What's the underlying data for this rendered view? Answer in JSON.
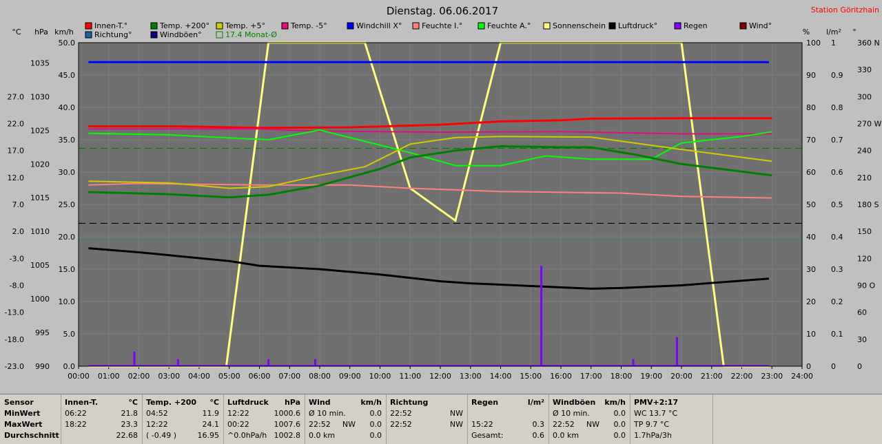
{
  "title": "Dienstag. 06.06.2017",
  "station": "Station Göritzhain",
  "colors": {
    "background": "#c0c0c0",
    "plot": "#707070",
    "grid": "#808080"
  },
  "axis_heads": {
    "temp": "°C",
    "press": "hPa",
    "wind": "km/h",
    "percent": "%",
    "rain": "l/m²",
    "dir": "°"
  },
  "legend": [
    {
      "label": "Innen-T.°",
      "color": "#ff0000"
    },
    {
      "label": "Temp. +200°",
      "color": "#008000"
    },
    {
      "label": "Temp. +5°",
      "color": "#cccc00"
    },
    {
      "label": "Temp. -5°",
      "color": "#e0107a"
    },
    {
      "label": "Windchill X°",
      "color": "#0000ff"
    },
    {
      "label": "Feuchte I.°",
      "color": "#ff8080"
    },
    {
      "label": "Feuchte A.°",
      "color": "#00ff00"
    },
    {
      "label": "Sonnenschein",
      "color": "#ffff80"
    },
    {
      "label": "Luftdruck°",
      "color": "#000000"
    },
    {
      "label": "Regen",
      "color": "#8000ff"
    },
    {
      "label": "Wind°",
      "color": "#800000"
    },
    {
      "label": "Richtung°",
      "color": "#2060a0"
    },
    {
      "label": "Windböen°",
      "color": "#000080"
    },
    {
      "label": "17.4 Monat-Ø",
      "color": "#008000",
      "outline": true
    }
  ],
  "chart_data": {
    "type": "line",
    "title": "Dienstag. 06.06.2017",
    "x_range": [
      0,
      24
    ],
    "x_ticks": [
      "00:00",
      "01:00",
      "02:00",
      "03:00",
      "04:00",
      "05:00",
      "06:00",
      "07:00",
      "08:00",
      "09:00",
      "10:00",
      "11:00",
      "12:00",
      "13:00",
      "14:00",
      "15:00",
      "16:00",
      "17:00",
      "18:00",
      "19:00",
      "20:00",
      "21:00",
      "22:00",
      "23:00",
      "24:00"
    ],
    "axes": {
      "temp": {
        "range": [
          -23.0,
          37.0
        ],
        "ticks": [
          "27.0",
          "22.0",
          "17.0",
          "12.0",
          "7.0",
          "2.0",
          "-3.0",
          "-8.0",
          "-13.0",
          "-18.0",
          "-23.0"
        ]
      },
      "press": {
        "range": [
          990,
          1038
        ],
        "ticks": [
          "1035",
          "1030",
          "1025",
          "1020",
          "1015",
          "1010",
          "1005",
          "1000",
          "995",
          "990"
        ]
      },
      "wind": {
        "range": [
          0,
          50
        ],
        "ticks": [
          "50.0",
          "45.0",
          "40.0",
          "35.0",
          "30.0",
          "25.0",
          "20.0",
          "15.0",
          "10.0",
          "5.0",
          "0.0"
        ]
      },
      "percent": {
        "range": [
          0,
          100
        ],
        "ticks": [
          "100",
          "90",
          "80",
          "70",
          "60",
          "50",
          "40",
          "30",
          "20",
          "10",
          "0"
        ]
      },
      "rain": {
        "range": [
          0,
          1
        ],
        "ticks": [
          "1",
          "0.9",
          "0.8",
          "0.7",
          "0.6",
          "0.5",
          "0.4",
          "0.3",
          "0.2",
          "0.1",
          "0"
        ]
      },
      "dir": {
        "range": [
          0,
          360
        ],
        "ticks": [
          "360 N",
          "330",
          "300",
          "270 W",
          "240",
          "210",
          "180 S",
          "150",
          "120",
          "90 O",
          "60",
          "30",
          "0"
        ]
      }
    },
    "series": [
      {
        "name": "Innen-T.°",
        "axis": "temp",
        "color": "#ff0000",
        "width": 3,
        "x": [
          0.33,
          3,
          6,
          9,
          12,
          14,
          16,
          17,
          20,
          23
        ],
        "y": [
          21.5,
          21.5,
          21.2,
          21.3,
          21.8,
          22.4,
          22.6,
          22.9,
          23.0,
          23.0
        ]
      },
      {
        "name": "Temp. -5°",
        "axis": "temp",
        "color": "#e0107a",
        "width": 2,
        "x": [
          0.33,
          6,
          8,
          12,
          16,
          20,
          23
        ],
        "y": [
          21.0,
          21.0,
          20.6,
          20.4,
          20.5,
          20.1,
          20.1
        ]
      },
      {
        "name": "Feuchte I.°",
        "axis": "percent",
        "color": "#ff8080",
        "width": 2,
        "x": [
          0.33,
          2,
          6,
          9,
          11,
          14,
          18,
          20,
          23
        ],
        "y": [
          56,
          56.5,
          56,
          56,
          55,
          54,
          53.5,
          52.5,
          52
        ]
      },
      {
        "name": "Feuchte A.°",
        "axis": "percent",
        "color": "#00ff00",
        "width": 2,
        "x": [
          0.33,
          3,
          6.3,
          8,
          11,
          12.5,
          14,
          15.5,
          17,
          19,
          20,
          22,
          23
        ],
        "y": [
          72,
          71.5,
          70,
          73,
          66,
          62,
          62,
          65,
          64,
          64,
          69,
          71,
          72.5
        ]
      },
      {
        "name": "Temp. +5°",
        "axis": "temp",
        "color": "#cccc00",
        "width": 2,
        "x": [
          0.33,
          3,
          5,
          6.3,
          8,
          9.5,
          11,
          12.5,
          14,
          17,
          20,
          23
        ],
        "y": [
          11.3,
          11.0,
          10.0,
          10.3,
          12.4,
          14.0,
          18.2,
          19.4,
          19.6,
          19.5,
          17.2,
          15.0
        ]
      },
      {
        "name": "Temp. +200°",
        "axis": "temp",
        "color": "#008000",
        "width": 3,
        "x": [
          0.33,
          3,
          5,
          6.3,
          8,
          10,
          11,
          12.5,
          14,
          16,
          17,
          18.5,
          20,
          23
        ],
        "y": [
          9.3,
          8.9,
          8.3,
          8.8,
          10.5,
          13.6,
          15.7,
          17.0,
          17.8,
          17.6,
          17.6,
          16.2,
          14.5,
          12.4
        ]
      },
      {
        "name": "Luftdruck°",
        "axis": "press",
        "color": "#000000",
        "width": 3,
        "x": [
          0.33,
          2,
          5,
          6,
          8,
          10,
          12,
          13,
          15,
          17,
          18,
          20,
          22.9
        ],
        "y": [
          1007.5,
          1006.9,
          1005.6,
          1004.9,
          1004.4,
          1003.6,
          1002.6,
          1002.3,
          1001.9,
          1001.5,
          1001.6,
          1002.0,
          1003.0
        ]
      },
      {
        "name": "Windböen°",
        "axis": "wind",
        "color": "#0000ff",
        "width": 3,
        "x": [
          0.33,
          22.9
        ],
        "y": [
          47.0,
          47.0
        ]
      }
    ],
    "sunshine": {
      "name": "Sonnenschein",
      "axis": "percent",
      "color": "#ffff80",
      "x": [
        0.33,
        4.9,
        6.3,
        9.5,
        11,
        12.5,
        14,
        20,
        21.4,
        22.9
      ],
      "y": [
        0,
        0,
        100,
        100,
        55,
        45,
        100,
        100,
        0,
        0
      ]
    },
    "reference_lines": [
      {
        "name": "17.4 Monat-Ø",
        "axis": "temp",
        "value": 17.4,
        "color": "#008000",
        "dash": "10,6"
      },
      {
        "name": "Null",
        "axis": "temp",
        "value": 3.5,
        "color": "#000000",
        "dash": "10,6"
      },
      {
        "name": "Grenze",
        "axis": "temp",
        "value": 0.4,
        "color": "#009090",
        "dash": "2,2"
      }
    ],
    "rain_bars": {
      "axis": "rain",
      "color": "#8000ff",
      "x": [
        1.85,
        3.3,
        6.3,
        7.85,
        15.35,
        18.4,
        19.85
      ],
      "y": [
        0.045,
        0.022,
        0.022,
        0.022,
        0.31,
        0.022,
        0.09
      ]
    }
  },
  "table": [
    {
      "head": [
        "Sensor",
        "",
        ""
      ],
      "rows": [
        [
          "MinWert",
          "",
          ""
        ],
        [
          "MaxWert",
          "",
          ""
        ],
        [
          "Durchschnitt",
          "",
          ""
        ]
      ]
    },
    {
      "head": [
        "Innen-T.",
        "",
        "°C"
      ],
      "rows": [
        [
          "06:22",
          "",
          "21.8"
        ],
        [
          "18:22",
          "",
          "23.3"
        ],
        [
          "",
          "",
          "22.68"
        ]
      ]
    },
    {
      "head": [
        "Temp. +200",
        "",
        "°C"
      ],
      "rows": [
        [
          "04:52",
          "",
          "11.9"
        ],
        [
          "12:22",
          "",
          "24.1"
        ],
        [
          "( -0.49 )",
          "",
          "16.95"
        ]
      ]
    },
    {
      "head": [
        "Luftdruck",
        "",
        "hPa"
      ],
      "rows": [
        [
          "12:22",
          "",
          "1000.6"
        ],
        [
          "00:22",
          "",
          "1007.6"
        ],
        [
          "^0.0hPa/h",
          "",
          "1002.8"
        ]
      ]
    },
    {
      "head": [
        "Wind",
        "",
        "km/h"
      ],
      "rows": [
        [
          "Ø 10 min.",
          "",
          "0.0"
        ],
        [
          "22:52",
          "NW",
          "0.0"
        ],
        [
          "0.0 km",
          "",
          "0.0"
        ]
      ]
    },
    {
      "head": [
        "Richtung",
        "",
        ""
      ],
      "rows": [
        [
          "22:52",
          "",
          "NW"
        ],
        [
          "22:52",
          "",
          "NW"
        ],
        [
          "",
          "",
          ""
        ]
      ]
    },
    {
      "head": [
        "Regen",
        "",
        "l/m²"
      ],
      "rows": [
        [
          "",
          "",
          ""
        ],
        [
          "15:22",
          "",
          "0.3"
        ],
        [
          "Gesamt:",
          "",
          "0.6"
        ]
      ]
    },
    {
      "head": [
        "Windböen",
        "",
        "km/h"
      ],
      "rows": [
        [
          "Ø 10 min.",
          "",
          "0.0"
        ],
        [
          "22:52",
          "NW",
          "0.0"
        ],
        [
          "0.0 km",
          "",
          "0.0"
        ]
      ]
    },
    {
      "head": [
        "PMV+2:17",
        "",
        ""
      ],
      "rows": [
        [
          "WC 13.7 °C",
          "",
          ""
        ],
        [
          "TP 9.7 °C",
          "",
          ""
        ],
        [
          "1.7hPa/3h",
          "",
          ""
        ]
      ]
    }
  ]
}
